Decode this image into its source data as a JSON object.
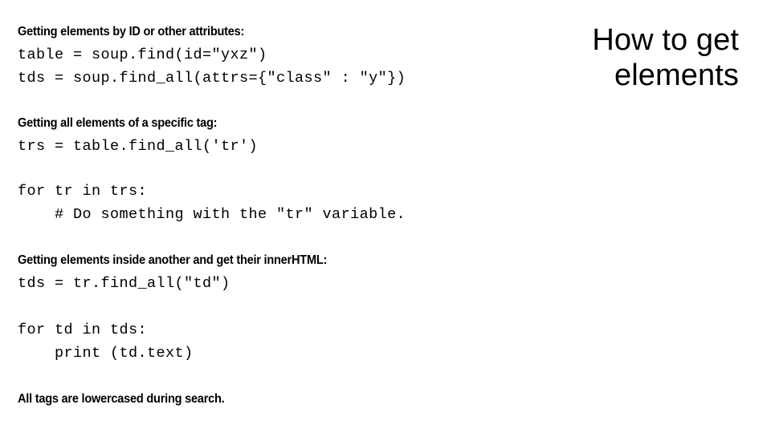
{
  "slide": {
    "title": "How to get elements",
    "title_lines": [
      "How to get",
      "elements"
    ],
    "background_color": "#ffffff",
    "text_color": "#000000"
  },
  "sections": [
    {
      "id": "by-id-or-attributes",
      "caption": "Getting elements by ID or other attributes:",
      "code_lines": [
        "table = soup.find(id=\"yxz\")",
        "tds = soup.find_all(attrs={\"class\" : \"y\"})"
      ]
    },
    {
      "id": "all-of-tag",
      "caption": "Getting all elements of a specific tag:",
      "code_lines": [
        "trs = table.find_all('tr')"
      ]
    },
    {
      "id": "loop-trs",
      "caption": "",
      "code_lines": [
        "for tr in trs:",
        "    # Do something with the \"tr\" variable."
      ]
    },
    {
      "id": "inside-another",
      "caption": "Getting elements inside another and get their innerHTML:",
      "code_lines": [
        "tds = tr.find_all(\"td\")"
      ]
    },
    {
      "id": "loop-tds",
      "caption": "",
      "code_lines": [
        "for td in tds:",
        "    print (td.text)"
      ]
    }
  ],
  "footnote": {
    "text": "All tags are lowercased during search."
  }
}
